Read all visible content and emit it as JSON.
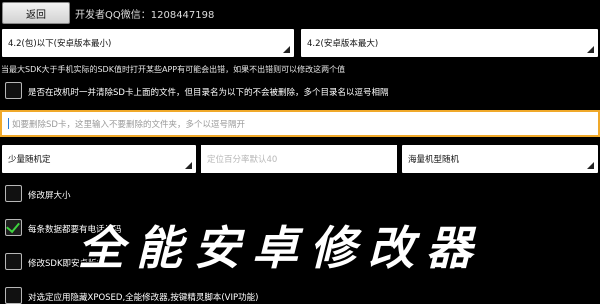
{
  "header": {
    "back_label": "返回",
    "developer_text": "开发者QQ微信：1208447198"
  },
  "sdk": {
    "min_select": "4.2(包)以下(安卓版本最小)",
    "max_select": "4.2(安卓版本最大)",
    "hint": "当最大SDK大于手机实际的SDK值时打开某些APP有可能会出错，如果不出错则可以修改这两个值"
  },
  "sd_clean": {
    "checkbox_label": "是否在改机时一并清除SD卡上面的文件，但目录名为以下的不会被删除，多个目录名以逗号相隔",
    "checked": false,
    "input_placeholder": "如要删除SD卡，这里输入不要删除的文件夹，多个以逗号隔开"
  },
  "random_row": {
    "location_select": "少量随机定",
    "percent_placeholder": "定位百分率默认40",
    "model_select": "海量机型随机"
  },
  "options": [
    {
      "label": "修改屏大小",
      "checked": false
    },
    {
      "label": "每条数据都要有电话号码",
      "checked": true
    },
    {
      "label": "修改SDK即安卓版本",
      "checked": false
    },
    {
      "label": "对选定应用隐藏XPOSED,全能修改器,按键精灵脚本(VIP功能)",
      "checked": false
    }
  ],
  "watermark": "全能安卓修改器",
  "colors": {
    "background": "#000000",
    "focus_border": "#f0a92a",
    "check_mark": "#3fd33f"
  }
}
